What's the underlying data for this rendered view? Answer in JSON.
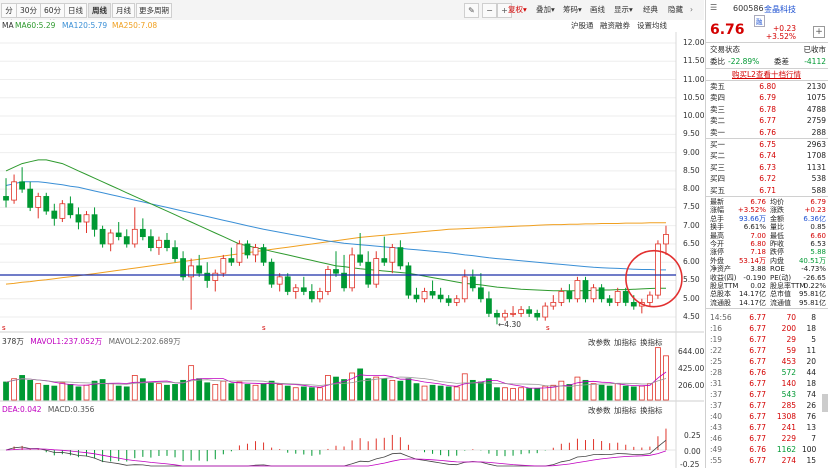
{
  "toolbar": {
    "periods": [
      "分时",
      "30分钟",
      "60分钟",
      "日线",
      "周线",
      "月线",
      "更多周期"
    ],
    "active_period": "周线",
    "right_items": [
      {
        "label": "复权",
        "color": "#d30000"
      },
      {
        "label": "叠加",
        "color": "#333333"
      },
      {
        "label": "筹码",
        "color": "#333333"
      },
      {
        "label": "画线",
        "color": "#333333"
      },
      {
        "label": "显示",
        "color": "#333333"
      },
      {
        "label": "经典",
        "color": "#333333"
      },
      {
        "label": "隐藏",
        "color": "#333333"
      }
    ]
  },
  "ma_line": {
    "ma": "MA",
    "ma60": "MA60:5.29",
    "ma120": "MA120:5.79",
    "ma250": "MA250:7.08"
  },
  "sub_links": {
    "link1": "沪股通",
    "link2": "融资融券",
    "link3": "设置均线"
  },
  "price_axis": [
    "12.00",
    "11.50",
    "11.00",
    "10.50",
    "10.00",
    "9.50",
    "9.00",
    "8.50",
    "8.00",
    "7.50",
    "7.00",
    "6.50",
    "6.00",
    "5.50",
    "5.00",
    "4.50"
  ],
  "low_marker": "4.30",
  "vol_pane": {
    "label_left": "378万",
    "mavol1": "MAVOL1:237.052万",
    "mavol2": "MAVOL2:202.689万",
    "btn1": "改参数",
    "btn2": "加指标",
    "btn3": "换指标",
    "axis": [
      "644.00",
      "425.00",
      "206.00"
    ]
  },
  "macd_pane": {
    "label_left": "DEA:0.042",
    "macd": "MACD:0.356",
    "btn1": "改参数",
    "btn2": "加指标",
    "btn3": "换指标",
    "axis": [
      "0.25",
      "0.00",
      "-0.25"
    ]
  },
  "colors": {
    "up": "#e0352b",
    "down": "#009933",
    "ma60": "#2e9a2e",
    "ma120": "#3a8fd6",
    "ma250": "#f0a020",
    "hline": "#1b2fa8",
    "circle": "#e23030"
  },
  "chart_data": {
    "type": "candlestick",
    "period": "weekly",
    "ylim": [
      4.2,
      12.3
    ],
    "candles": [
      {
        "o": 7.8,
        "h": 8.3,
        "l": 7.5,
        "c": 7.7
      },
      {
        "o": 7.7,
        "h": 8.4,
        "l": 7.6,
        "c": 8.2
      },
      {
        "o": 8.2,
        "h": 8.6,
        "l": 7.9,
        "c": 8.0
      },
      {
        "o": 8.0,
        "h": 8.2,
        "l": 7.4,
        "c": 7.5
      },
      {
        "o": 7.5,
        "h": 7.9,
        "l": 7.2,
        "c": 7.8
      },
      {
        "o": 7.8,
        "h": 7.9,
        "l": 7.3,
        "c": 7.4
      },
      {
        "o": 7.4,
        "h": 7.6,
        "l": 7.0,
        "c": 7.2
      },
      {
        "o": 7.2,
        "h": 7.7,
        "l": 7.1,
        "c": 7.6
      },
      {
        "o": 7.6,
        "h": 7.8,
        "l": 7.2,
        "c": 7.3
      },
      {
        "o": 7.3,
        "h": 7.5,
        "l": 6.9,
        "c": 7.1
      },
      {
        "o": 7.1,
        "h": 7.4,
        "l": 6.8,
        "c": 7.3
      },
      {
        "o": 7.3,
        "h": 7.5,
        "l": 6.7,
        "c": 6.9
      },
      {
        "o": 6.9,
        "h": 7.0,
        "l": 6.4,
        "c": 6.5
      },
      {
        "o": 6.5,
        "h": 6.9,
        "l": 6.3,
        "c": 6.8
      },
      {
        "o": 6.8,
        "h": 7.1,
        "l": 6.6,
        "c": 6.7
      },
      {
        "o": 6.7,
        "h": 6.9,
        "l": 6.4,
        "c": 6.5
      },
      {
        "o": 6.5,
        "h": 7.5,
        "l": 6.4,
        "c": 6.9
      },
      {
        "o": 6.9,
        "h": 7.2,
        "l": 6.6,
        "c": 6.7
      },
      {
        "o": 6.7,
        "h": 6.9,
        "l": 6.3,
        "c": 6.4
      },
      {
        "o": 6.4,
        "h": 6.7,
        "l": 6.2,
        "c": 6.6
      },
      {
        "o": 6.6,
        "h": 6.8,
        "l": 6.3,
        "c": 6.4
      },
      {
        "o": 6.4,
        "h": 6.6,
        "l": 6.0,
        "c": 6.1
      },
      {
        "o": 6.1,
        "h": 6.3,
        "l": 5.5,
        "c": 5.6
      },
      {
        "o": 5.6,
        "h": 6.1,
        "l": 4.7,
        "c": 5.9
      },
      {
        "o": 5.9,
        "h": 6.2,
        "l": 5.6,
        "c": 5.7
      },
      {
        "o": 5.7,
        "h": 6.0,
        "l": 5.3,
        "c": 5.5
      },
      {
        "o": 5.5,
        "h": 5.8,
        "l": 5.2,
        "c": 5.7
      },
      {
        "o": 5.7,
        "h": 6.2,
        "l": 5.6,
        "c": 6.1
      },
      {
        "o": 6.1,
        "h": 6.4,
        "l": 5.9,
        "c": 6.0
      },
      {
        "o": 6.0,
        "h": 6.6,
        "l": 5.9,
        "c": 6.5
      },
      {
        "o": 6.5,
        "h": 6.6,
        "l": 6.1,
        "c": 6.2
      },
      {
        "o": 6.2,
        "h": 6.5,
        "l": 6.0,
        "c": 6.4
      },
      {
        "o": 6.4,
        "h": 6.5,
        "l": 5.9,
        "c": 6.0
      },
      {
        "o": 6.0,
        "h": 6.1,
        "l": 5.3,
        "c": 5.4
      },
      {
        "o": 5.4,
        "h": 5.7,
        "l": 5.2,
        "c": 5.6
      },
      {
        "o": 5.6,
        "h": 5.7,
        "l": 5.1,
        "c": 5.2
      },
      {
        "o": 5.2,
        "h": 5.4,
        "l": 5.0,
        "c": 5.3
      },
      {
        "o": 5.3,
        "h": 5.6,
        "l": 5.1,
        "c": 5.2
      },
      {
        "o": 5.2,
        "h": 5.4,
        "l": 4.9,
        "c": 5.0
      },
      {
        "o": 5.0,
        "h": 5.3,
        "l": 4.9,
        "c": 5.2
      },
      {
        "o": 5.2,
        "h": 5.9,
        "l": 5.1,
        "c": 5.8
      },
      {
        "o": 5.8,
        "h": 6.3,
        "l": 5.6,
        "c": 5.7
      },
      {
        "o": 5.7,
        "h": 6.2,
        "l": 5.2,
        "c": 5.3
      },
      {
        "o": 5.3,
        "h": 6.4,
        "l": 5.2,
        "c": 6.2
      },
      {
        "o": 6.2,
        "h": 6.8,
        "l": 5.9,
        "c": 6.0
      },
      {
        "o": 6.0,
        "h": 6.3,
        "l": 5.3,
        "c": 5.4
      },
      {
        "o": 5.4,
        "h": 6.3,
        "l": 5.3,
        "c": 6.1
      },
      {
        "o": 6.1,
        "h": 6.7,
        "l": 5.9,
        "c": 6.0
      },
      {
        "o": 6.0,
        "h": 6.5,
        "l": 5.7,
        "c": 6.4
      },
      {
        "o": 6.4,
        "h": 6.6,
        "l": 5.8,
        "c": 5.9
      },
      {
        "o": 5.9,
        "h": 6.0,
        "l": 5.0,
        "c": 5.1
      },
      {
        "o": 5.1,
        "h": 5.3,
        "l": 4.9,
        "c": 5.0
      },
      {
        "o": 5.0,
        "h": 5.3,
        "l": 4.9,
        "c": 5.2
      },
      {
        "o": 5.2,
        "h": 5.5,
        "l": 5.0,
        "c": 5.1
      },
      {
        "o": 5.1,
        "h": 5.3,
        "l": 4.9,
        "c": 5.0
      },
      {
        "o": 5.0,
        "h": 5.1,
        "l": 4.8,
        "c": 4.9
      },
      {
        "o": 4.9,
        "h": 5.1,
        "l": 4.8,
        "c": 5.0
      },
      {
        "o": 5.0,
        "h": 5.8,
        "l": 4.9,
        "c": 5.6
      },
      {
        "o": 5.6,
        "h": 5.8,
        "l": 5.2,
        "c": 5.3
      },
      {
        "o": 5.3,
        "h": 5.7,
        "l": 4.9,
        "c": 5.0
      },
      {
        "o": 5.0,
        "h": 5.2,
        "l": 4.5,
        "c": 4.6
      },
      {
        "o": 4.6,
        "h": 4.7,
        "l": 4.3,
        "c": 4.5
      },
      {
        "o": 4.5,
        "h": 4.7,
        "l": 4.4,
        "c": 4.6
      },
      {
        "o": 4.6,
        "h": 4.8,
        "l": 4.5,
        "c": 4.6
      },
      {
        "o": 4.6,
        "h": 4.8,
        "l": 4.5,
        "c": 4.7
      },
      {
        "o": 4.7,
        "h": 4.8,
        "l": 4.5,
        "c": 4.6
      },
      {
        "o": 4.6,
        "h": 4.7,
        "l": 4.4,
        "c": 4.5
      },
      {
        "o": 4.5,
        "h": 4.9,
        "l": 4.4,
        "c": 4.8
      },
      {
        "o": 4.8,
        "h": 5.1,
        "l": 4.7,
        "c": 4.9
      },
      {
        "o": 4.9,
        "h": 5.3,
        "l": 4.8,
        "c": 5.2
      },
      {
        "o": 5.2,
        "h": 5.4,
        "l": 4.9,
        "c": 5.0
      },
      {
        "o": 5.0,
        "h": 5.6,
        "l": 4.9,
        "c": 5.5
      },
      {
        "o": 5.5,
        "h": 5.6,
        "l": 4.9,
        "c": 5.0
      },
      {
        "o": 5.0,
        "h": 5.4,
        "l": 4.9,
        "c": 5.3
      },
      {
        "o": 5.3,
        "h": 5.4,
        "l": 4.9,
        "c": 5.0
      },
      {
        "o": 5.0,
        "h": 5.1,
        "l": 4.8,
        "c": 4.9
      },
      {
        "o": 4.9,
        "h": 5.3,
        "l": 4.8,
        "c": 5.2
      },
      {
        "o": 5.2,
        "h": 5.3,
        "l": 4.8,
        "c": 4.9
      },
      {
        "o": 4.9,
        "h": 5.1,
        "l": 4.7,
        "c": 4.8
      },
      {
        "o": 4.8,
        "h": 5.0,
        "l": 4.6,
        "c": 4.9
      },
      {
        "o": 4.9,
        "h": 5.2,
        "l": 4.8,
        "c": 5.1
      },
      {
        "o": 5.1,
        "h": 6.6,
        "l": 5.0,
        "c": 6.5
      },
      {
        "o": 6.5,
        "h": 7.0,
        "l": 6.2,
        "c": 6.76
      }
    ],
    "volume": [
      220,
      260,
      300,
      240,
      200,
      180,
      170,
      210,
      190,
      160,
      180,
      230,
      250,
      200,
      170,
      160,
      300,
      260,
      220,
      200,
      180,
      190,
      240,
      420,
      260,
      210,
      190,
      230,
      200,
      220,
      190,
      180,
      200,
      230,
      190,
      170,
      150,
      160,
      150,
      150,
      300,
      280,
      250,
      330,
      380,
      260,
      280,
      260,
      240,
      230,
      260,
      200,
      170,
      180,
      170,
      160,
      160,
      320,
      240,
      220,
      260,
      150,
      150,
      140,
      150,
      140,
      140,
      170,
      180,
      230,
      190,
      280,
      240,
      200,
      180,
      170,
      200,
      170,
      160,
      170,
      200,
      640,
      540
    ],
    "ma60": [
      8.5,
      8.6,
      8.7,
      8.75,
      8.8,
      8.8,
      8.75,
      8.7,
      8.6,
      8.5,
      8.4,
      8.3,
      8.2,
      8.1,
      8.0,
      7.9,
      7.8,
      7.7,
      7.6,
      7.5,
      7.4,
      7.3,
      7.2,
      7.1,
      7.0,
      6.9,
      6.8,
      6.7,
      6.6,
      6.5,
      6.45,
      6.4,
      6.35,
      6.3,
      6.25,
      6.2,
      6.15,
      6.1,
      6.05,
      6.0,
      5.95,
      5.9,
      5.88,
      5.85,
      5.82,
      5.8,
      5.78,
      5.76,
      5.74,
      5.72,
      5.7,
      5.66,
      5.62,
      5.58,
      5.54,
      5.5,
      5.46,
      5.42,
      5.4,
      5.38,
      5.35,
      5.32,
      5.3,
      5.28,
      5.26,
      5.25,
      5.24,
      5.23,
      5.22,
      5.22,
      5.22,
      5.22,
      5.22,
      5.23,
      5.24,
      5.24,
      5.25,
      5.25,
      5.26,
      5.27,
      5.28,
      5.29,
      5.29
    ],
    "ma120": [
      8.1,
      8.15,
      8.2,
      8.2,
      8.2,
      8.18,
      8.15,
      8.12,
      8.08,
      8.05,
      8.0,
      7.95,
      7.9,
      7.85,
      7.8,
      7.75,
      7.7,
      7.65,
      7.6,
      7.55,
      7.5,
      7.45,
      7.4,
      7.35,
      7.3,
      7.25,
      7.2,
      7.15,
      7.1,
      7.05,
      7.0,
      6.95,
      6.9,
      6.86,
      6.82,
      6.78,
      6.74,
      6.7,
      6.66,
      6.62,
      6.58,
      6.55,
      6.52,
      6.5,
      6.48,
      6.46,
      6.44,
      6.42,
      6.4,
      6.38,
      6.36,
      6.34,
      6.32,
      6.3,
      6.28,
      6.26,
      6.23,
      6.2,
      6.18,
      6.15,
      6.12,
      6.1,
      6.08,
      6.06,
      6.04,
      6.02,
      6.0,
      5.98,
      5.96,
      5.94,
      5.92,
      5.9,
      5.88,
      5.86,
      5.85,
      5.84,
      5.83,
      5.82,
      5.81,
      5.8,
      5.8,
      5.79,
      5.79
    ],
    "ma250": [
      5.4,
      5.42,
      5.45,
      5.47,
      5.5,
      5.52,
      5.55,
      5.58,
      5.6,
      5.63,
      5.66,
      5.69,
      5.72,
      5.75,
      5.78,
      5.81,
      5.84,
      5.87,
      5.9,
      5.93,
      5.96,
      5.99,
      6.02,
      6.05,
      6.08,
      6.11,
      6.14,
      6.17,
      6.2,
      6.23,
      6.26,
      6.29,
      6.32,
      6.35,
      6.38,
      6.41,
      6.44,
      6.47,
      6.5,
      6.53,
      6.56,
      6.59,
      6.62,
      6.65,
      6.68,
      6.7,
      6.72,
      6.74,
      6.76,
      6.78,
      6.8,
      6.82,
      6.84,
      6.86,
      6.88,
      6.9,
      6.91,
      6.92,
      6.93,
      6.94,
      6.95,
      6.96,
      6.97,
      6.98,
      6.99,
      7.0,
      7.01,
      7.02,
      7.03,
      7.03,
      7.04,
      7.04,
      7.05,
      7.05,
      7.06,
      7.06,
      7.06,
      7.07,
      7.07,
      7.07,
      7.08,
      7.08,
      7.08
    ],
    "hline": 5.65
  },
  "quote": {
    "code": "600586",
    "name": "金晶科技",
    "tag": "融",
    "price": "6.76",
    "change": "+0.23",
    "change_pct": "+3.52%",
    "status_label": "交易状态",
    "status_value": "已收市",
    "weibi_label": "委比",
    "weibi": "-22.89%",
    "weicha_label": "委差",
    "weicha": "-4112",
    "promo": "购买L2查看十档行情",
    "asks": [
      {
        "label": "卖五",
        "price": "6.80",
        "vol": "2130"
      },
      {
        "label": "卖四",
        "price": "6.79",
        "vol": "1075"
      },
      {
        "label": "卖三",
        "price": "6.78",
        "vol": "4788"
      },
      {
        "label": "卖二",
        "price": "6.77",
        "vol": "2759"
      },
      {
        "label": "卖一",
        "price": "6.76",
        "vol": "288"
      }
    ],
    "bids": [
      {
        "label": "买一",
        "price": "6.75",
        "vol": "2963"
      },
      {
        "label": "买二",
        "price": "6.74",
        "vol": "1708"
      },
      {
        "label": "买三",
        "price": "6.73",
        "vol": "1131"
      },
      {
        "label": "买四",
        "price": "6.72",
        "vol": "538"
      },
      {
        "label": "买五",
        "price": "6.71",
        "vol": "588"
      }
    ],
    "stats": [
      {
        "l1": "最新",
        "v1": "6.76",
        "c1": "red",
        "l2": "均价",
        "v2": "6.79",
        "c2": "red"
      },
      {
        "l1": "涨幅",
        "v1": "+3.52%",
        "c1": "red",
        "l2": "涨跌",
        "v2": "+0.23",
        "c2": "red"
      },
      {
        "l1": "总手",
        "v1": "93.66万",
        "c1": "blue",
        "l2": "金额",
        "v2": "6.36亿",
        "c2": "blue"
      },
      {
        "l1": "换手",
        "v1": "6.61%",
        "c1": "dark",
        "l2": "量比",
        "v2": "0.85",
        "c2": "dark"
      },
      {
        "l1": "最高",
        "v1": "7.00",
        "c1": "red",
        "l2": "最低",
        "v2": "6.60",
        "c2": "red"
      },
      {
        "l1": "今开",
        "v1": "6.80",
        "c1": "red",
        "l2": "昨收",
        "v2": "6.53",
        "c2": "dark"
      },
      {
        "l1": "涨停",
        "v1": "7.18",
        "c1": "red",
        "l2": "跌停",
        "v2": "5.88",
        "c2": "green"
      },
      {
        "l1": "外盘",
        "v1": "53.14万",
        "c1": "red",
        "l2": "内盘",
        "v2": "40.51万",
        "c2": "green"
      },
      {
        "l1": "净资产",
        "v1": "3.88",
        "c1": "dark",
        "l2": "ROE",
        "v2": "-4.73%",
        "c2": "dark"
      },
      {
        "l1": "收益(四)",
        "v1": "-0.190",
        "c1": "dark",
        "l2": "PE(动)",
        "v2": "-26.65",
        "c2": "dark"
      },
      {
        "l1": "股息TTM",
        "v1": "0.02",
        "c1": "dark",
        "l2": "股息率TTM",
        "v2": "0.22%",
        "c2": "dark"
      },
      {
        "l1": "总股本",
        "v1": "14.17亿",
        "c1": "dark",
        "l2": "总市值",
        "v2": "95.81亿",
        "c2": "dark"
      },
      {
        "l1": "流通股",
        "v1": "14.17亿",
        "c1": "dark",
        "l2": "流通值",
        "v2": "95.81亿",
        "c2": "dark"
      }
    ],
    "trades": [
      {
        "time": "14:56",
        "price": "6.77",
        "vol": "70",
        "n": "8",
        "vc": "red"
      },
      {
        "time": ":16",
        "price": "6.77",
        "vol": "200",
        "n": "18",
        "vc": "red"
      },
      {
        "time": ":19",
        "price": "6.77",
        "vol": "29",
        "n": "5",
        "vc": "red"
      },
      {
        "time": ":22",
        "price": "6.77",
        "vol": "59",
        "n": "11",
        "vc": "red"
      },
      {
        "time": ":25",
        "price": "6.77",
        "vol": "453",
        "n": "20",
        "vc": "red"
      },
      {
        "time": ":28",
        "price": "6.76",
        "vol": "572",
        "n": "44",
        "vc": "green"
      },
      {
        "time": ":31",
        "price": "6.77",
        "vol": "140",
        "n": "18",
        "vc": "red"
      },
      {
        "time": ":37",
        "price": "6.77",
        "vol": "543",
        "n": "74",
        "vc": "green"
      },
      {
        "time": ":37",
        "price": "6.77",
        "vol": "285",
        "n": "26",
        "vc": "red"
      },
      {
        "time": ":40",
        "price": "6.77",
        "vol": "1308",
        "n": "76",
        "vc": "red"
      },
      {
        "time": ":43",
        "price": "6.77",
        "vol": "241",
        "n": "13",
        "vc": "red"
      },
      {
        "time": ":46",
        "price": "6.77",
        "vol": "229",
        "n": "7",
        "vc": "red"
      },
      {
        "time": ":49",
        "price": "6.76",
        "vol": "1162",
        "n": "100",
        "vc": "green"
      },
      {
        "time": ":55",
        "price": "6.77",
        "vol": "274",
        "n": "15",
        "vc": "red"
      }
    ]
  }
}
